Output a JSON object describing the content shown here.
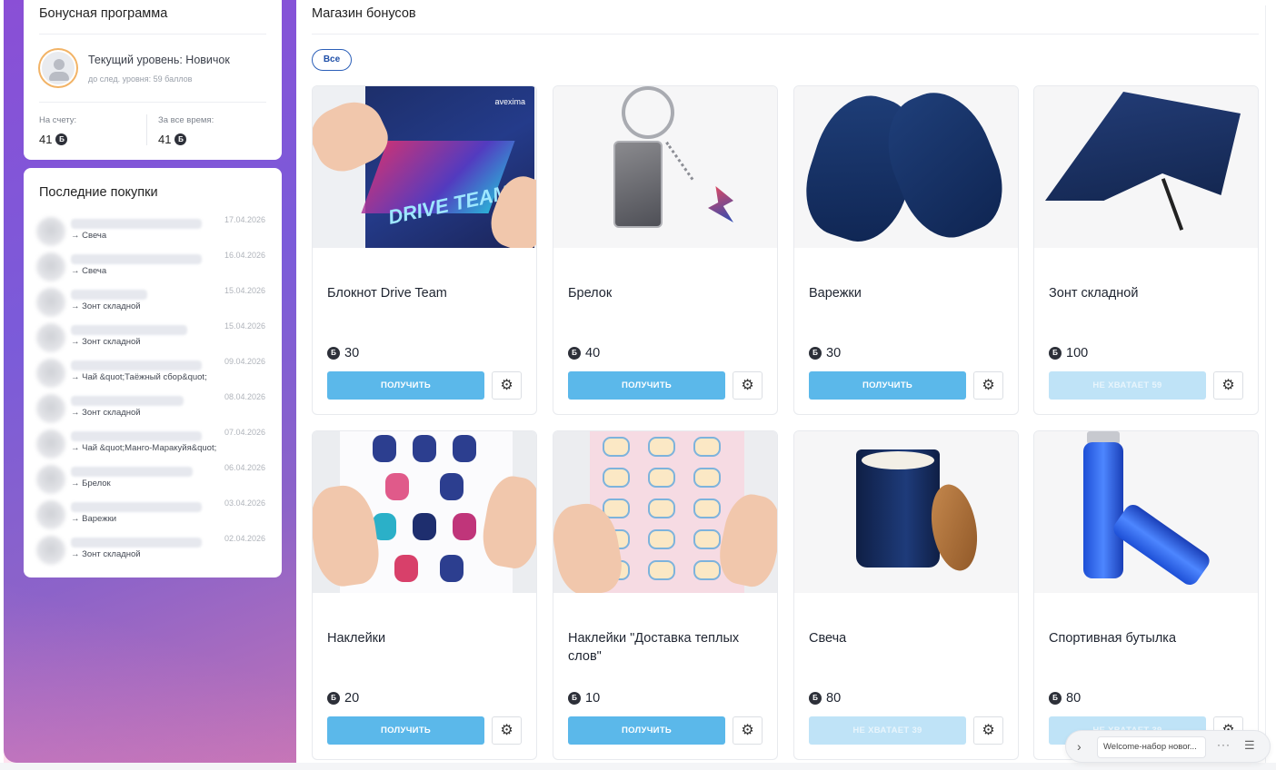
{
  "bonus": {
    "title": "Бонусная программа",
    "level": "Текущий уровень: Новичок",
    "next_level": "до след. уровня: 59 баллов",
    "balance_label": "На счету:",
    "balance_value": "41",
    "total_label": "За все время:",
    "total_value": "41",
    "coin_symbol": "Б"
  },
  "purchases": {
    "title": "Последние покупки",
    "items": [
      {
        "date": "17.04.2026",
        "item": "→ Свеча"
      },
      {
        "date": "16.04.2026",
        "item": "→ Свеча"
      },
      {
        "date": "15.04.2026",
        "item": "→ Зонт складной"
      },
      {
        "date": "15.04.2026",
        "item": "→ Зонт складной"
      },
      {
        "date": "09.04.2026",
        "item": "→ Чай &quot;Таёжный сбор&quot;"
      },
      {
        "date": "08.04.2026",
        "item": "→ Зонт складной"
      },
      {
        "date": "07.04.2026",
        "item": "→ Чай &quot;Манго-Маракуйя&quot;"
      },
      {
        "date": "06.04.2026",
        "item": "→ Брелок"
      },
      {
        "date": "03.04.2026",
        "item": "→ Варежки"
      },
      {
        "date": "02.04.2026",
        "item": "→ Зонт складной"
      }
    ]
  },
  "shop": {
    "title": "Магазин бонусов",
    "filter_all": "Все",
    "products": [
      {
        "name": "Блокнот Drive Team",
        "price": "30",
        "button": "ПОЛУЧИТЬ",
        "available": true,
        "art_text": "DRIVE TEAM",
        "logo": "avexima"
      },
      {
        "name": "Брелок",
        "price": "40",
        "button": "ПОЛУЧИТЬ",
        "available": true
      },
      {
        "name": "Варежки",
        "price": "30",
        "button": "ПОЛУЧИТЬ",
        "available": true
      },
      {
        "name": "Зонт складной",
        "price": "100",
        "button": "НЕ ХВАТАЕТ 59",
        "available": false
      },
      {
        "name": "Наклейки",
        "price": "20",
        "button": "ПОЛУЧИТЬ",
        "available": true
      },
      {
        "name": "Наклейки \"Доставка теплых слов\"",
        "price": "10",
        "button": "ПОЛУЧИТЬ",
        "available": true
      },
      {
        "name": "Свеча",
        "price": "80",
        "button": "НЕ ХВАТАЕТ 39",
        "available": false
      },
      {
        "name": "Спортивная бутылка",
        "price": "80",
        "button": "НЕ ХВАТАЕТ 39",
        "available": false
      }
    ]
  },
  "widget": {
    "text": "Welcome-набор новог...",
    "chevron": "›",
    "dots": "···",
    "menu": "☰"
  },
  "icons": {
    "gear": "⚙"
  },
  "colors": {
    "accent_button": "#5bb8ea",
    "disabled_button": "#bfe3f7",
    "sidebar_gradient_start": "#8a4fd6",
    "sidebar_gradient_end": "#c073b6"
  }
}
